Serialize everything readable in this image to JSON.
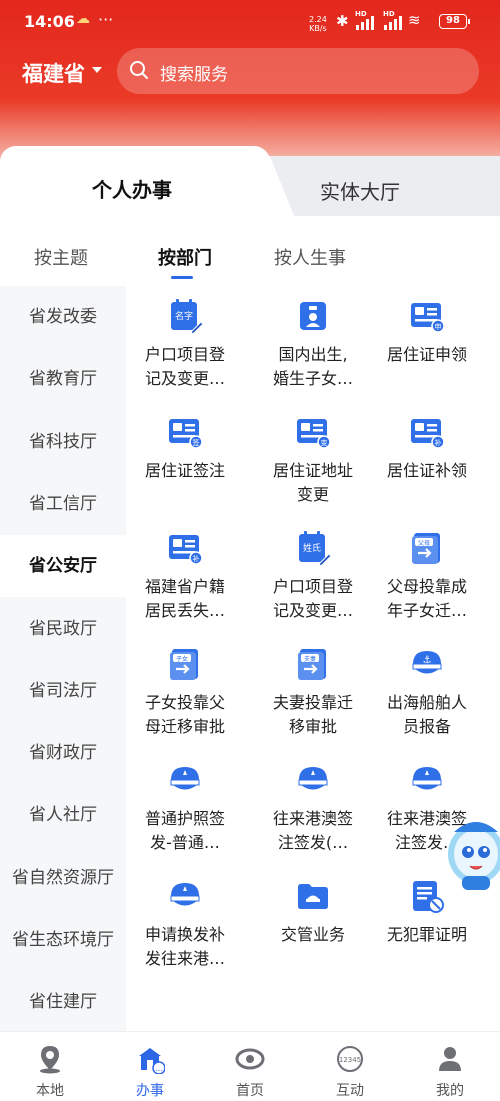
{
  "status_bar": {
    "time": "14:06",
    "speed_value": "2.24",
    "speed_unit": "KB/s",
    "battery": "98",
    "hd1": "HD",
    "hd2": "HD"
  },
  "header": {
    "province": "福建省",
    "search_placeholder": "搜索服务"
  },
  "main_tabs": [
    {
      "label": "个人办事",
      "active": true
    },
    {
      "label": "实体大厅",
      "active": false
    }
  ],
  "filter_tabs": [
    {
      "label": "按主题"
    },
    {
      "label": "按部门",
      "active": true
    },
    {
      "label": "按人生事"
    }
  ],
  "sidebar": [
    "省发改委",
    "省教育厅",
    "省科技厅",
    "省工信厅",
    "省公安厅",
    "省民政厅",
    "省司法厅",
    "省财政厅",
    "省人社厅",
    "省自然资源厅",
    "省生态环境厅",
    "省住建厅"
  ],
  "sidebar_active_index": 4,
  "services": [
    {
      "line1": "户口项目登",
      "line2": "记及变更…",
      "icon": "name-card-edit-icon",
      "badge": "名字"
    },
    {
      "line1": "国内出生,",
      "line2": "婚生子女…",
      "icon": "id-badge-icon"
    },
    {
      "line1": "居住证申领",
      "line2": "",
      "icon": "residence-card-apply-icon",
      "badge": "申"
    },
    {
      "line1": "居住证签注",
      "line2": "",
      "icon": "residence-card-endorse-icon",
      "badge": "签"
    },
    {
      "line1": "居住证地址",
      "line2": "变更",
      "icon": "residence-card-address-icon",
      "badge": "变"
    },
    {
      "line1": "居住证补领",
      "line2": "",
      "icon": "residence-card-reissue-icon",
      "badge": "补"
    },
    {
      "line1": "福建省户籍",
      "line2": "居民丢失…",
      "icon": "id-card-reissue-icon",
      "badge": "补"
    },
    {
      "line1": "户口项目登",
      "line2": "记及变更…",
      "icon": "surname-edit-icon",
      "badge": "姓氏"
    },
    {
      "line1": "父母投靠成",
      "line2": "年子女迁…",
      "icon": "parents-transfer-book-icon",
      "badge": "父母"
    },
    {
      "line1": "子女投靠父",
      "line2": "母迁移审批",
      "icon": "children-transfer-book-icon",
      "badge": "子女"
    },
    {
      "line1": "夫妻投靠迁",
      "line2": "移审批",
      "icon": "spouse-transfer-book-icon",
      "badge": "夫妻"
    },
    {
      "line1": "出海船舶人",
      "line2": "员报备",
      "icon": "anchor-cap-icon"
    },
    {
      "line1": "普通护照签",
      "line2": "发-普通…",
      "icon": "police-cap-icon"
    },
    {
      "line1": "往来港澳签",
      "line2": "注签发(…",
      "icon": "police-cap-icon"
    },
    {
      "line1": "往来港澳签",
      "line2": "注签发…",
      "icon": "police-cap-icon"
    },
    {
      "line1": "申请换发补",
      "line2": "发往来港…",
      "icon": "police-cap-icon"
    },
    {
      "line1": "交管业务",
      "line2": "",
      "icon": "traffic-folder-icon"
    },
    {
      "line1": "无犯罪证明",
      "line2": "",
      "icon": "no-crime-certificate-icon"
    }
  ],
  "bottom_nav": [
    {
      "label": "本地",
      "icon": "location-pin-icon"
    },
    {
      "label": "办事",
      "icon": "service-hall-icon",
      "active": true
    },
    {
      "label": "首页",
      "icon": "home-eye-icon"
    },
    {
      "label": "互动",
      "icon": "hotline-12345-icon",
      "badge": "12345"
    },
    {
      "label": "我的",
      "icon": "user-profile-icon"
    }
  ],
  "colors": {
    "brand_red": "#e3271d",
    "accent_blue": "#2e67e6",
    "icon_blue": "#2f6fe8"
  }
}
